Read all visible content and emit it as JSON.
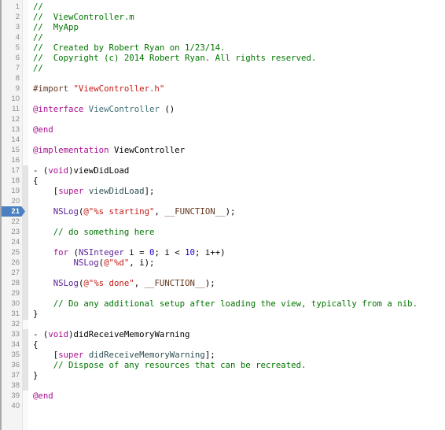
{
  "editor": {
    "file": "ViewController.m",
    "breakpoint_line": 21,
    "colors": {
      "comment": "#007400",
      "keyword": "#aa0d91",
      "string": "#c41a16",
      "number": "#1c00cf",
      "preproc": "#643820",
      "type": "#5c2699",
      "class": "#3f6e74",
      "method": "#2e4d52",
      "breakpoint": "#4a7fc1"
    },
    "lines": [
      {
        "n": "1",
        "tokens": [
          [
            "comment",
            "//"
          ]
        ]
      },
      {
        "n": "2",
        "tokens": [
          [
            "comment",
            "//  ViewController.m"
          ]
        ]
      },
      {
        "n": "3",
        "tokens": [
          [
            "comment",
            "//  MyApp"
          ]
        ]
      },
      {
        "n": "4",
        "tokens": [
          [
            "comment",
            "//"
          ]
        ]
      },
      {
        "n": "5",
        "tokens": [
          [
            "comment",
            "//  Created by Robert Ryan on 1/23/14."
          ]
        ]
      },
      {
        "n": "6",
        "tokens": [
          [
            "comment",
            "//  Copyright (c) 2014 Robert Ryan. All rights reserved."
          ]
        ]
      },
      {
        "n": "7",
        "tokens": [
          [
            "comment",
            "//"
          ]
        ]
      },
      {
        "n": "8",
        "tokens": []
      },
      {
        "n": "9",
        "tokens": [
          [
            "preproc",
            "#import "
          ],
          [
            "string",
            "\"ViewController.h\""
          ]
        ]
      },
      {
        "n": "10",
        "tokens": []
      },
      {
        "n": "11",
        "tokens": [
          [
            "keyword",
            "@interface"
          ],
          [
            "plain",
            " "
          ],
          [
            "class",
            "ViewController"
          ],
          [
            "plain",
            " ()"
          ]
        ]
      },
      {
        "n": "12",
        "tokens": []
      },
      {
        "n": "13",
        "tokens": [
          [
            "keyword",
            "@end"
          ]
        ]
      },
      {
        "n": "14",
        "tokens": []
      },
      {
        "n": "15",
        "tokens": [
          [
            "keyword",
            "@implementation"
          ],
          [
            "plain",
            " ViewController"
          ]
        ]
      },
      {
        "n": "16",
        "tokens": []
      },
      {
        "n": "17",
        "tokens": [
          [
            "plain",
            "- ("
          ],
          [
            "keyword",
            "void"
          ],
          [
            "plain",
            ")viewDidLoad"
          ]
        ]
      },
      {
        "n": "18",
        "tokens": [
          [
            "plain",
            "{"
          ]
        ]
      },
      {
        "n": "19",
        "tokens": [
          [
            "plain",
            "    ["
          ],
          [
            "keyword",
            "super"
          ],
          [
            "plain",
            " "
          ],
          [
            "method",
            "viewDidLoad"
          ],
          [
            "plain",
            "];"
          ]
        ]
      },
      {
        "n": "20",
        "tokens": []
      },
      {
        "n": "21",
        "tokens": [
          [
            "plain",
            "    "
          ],
          [
            "type",
            "NSLog"
          ],
          [
            "plain",
            "("
          ],
          [
            "string",
            "@\"%s starting\""
          ],
          [
            "plain",
            ", "
          ],
          [
            "macro",
            "__FUNCTION__"
          ],
          [
            "plain",
            ");"
          ]
        ]
      },
      {
        "n": "22",
        "tokens": []
      },
      {
        "n": "23",
        "tokens": [
          [
            "plain",
            "    "
          ],
          [
            "comment",
            "// do something here"
          ]
        ]
      },
      {
        "n": "24",
        "tokens": []
      },
      {
        "n": "25",
        "tokens": [
          [
            "plain",
            "    "
          ],
          [
            "keyword",
            "for"
          ],
          [
            "plain",
            " ("
          ],
          [
            "type",
            "NSInteger"
          ],
          [
            "plain",
            " i = "
          ],
          [
            "number",
            "0"
          ],
          [
            "plain",
            "; i < "
          ],
          [
            "number",
            "10"
          ],
          [
            "plain",
            "; i++)"
          ]
        ]
      },
      {
        "n": "26",
        "tokens": [
          [
            "plain",
            "        "
          ],
          [
            "type",
            "NSLog"
          ],
          [
            "plain",
            "("
          ],
          [
            "string",
            "@\"%d\""
          ],
          [
            "plain",
            ", i);"
          ]
        ]
      },
      {
        "n": "27",
        "tokens": []
      },
      {
        "n": "28",
        "tokens": [
          [
            "plain",
            "    "
          ],
          [
            "type",
            "NSLog"
          ],
          [
            "plain",
            "("
          ],
          [
            "string",
            "@\"%s done\""
          ],
          [
            "plain",
            ", "
          ],
          [
            "macro",
            "__FUNCTION__"
          ],
          [
            "plain",
            ");"
          ]
        ]
      },
      {
        "n": "29",
        "tokens": []
      },
      {
        "n": "30",
        "tokens": [
          [
            "plain",
            "    "
          ],
          [
            "comment",
            "// Do any additional setup after loading the view, typically from a nib."
          ]
        ]
      },
      {
        "n": "31",
        "tokens": [
          [
            "plain",
            "}"
          ]
        ]
      },
      {
        "n": "32",
        "tokens": []
      },
      {
        "n": "33",
        "tokens": [
          [
            "plain",
            "- ("
          ],
          [
            "keyword",
            "void"
          ],
          [
            "plain",
            ")didReceiveMemoryWarning"
          ]
        ]
      },
      {
        "n": "34",
        "tokens": [
          [
            "plain",
            "{"
          ]
        ]
      },
      {
        "n": "35",
        "tokens": [
          [
            "plain",
            "    ["
          ],
          [
            "keyword",
            "super"
          ],
          [
            "plain",
            " "
          ],
          [
            "method",
            "didReceiveMemoryWarning"
          ],
          [
            "plain",
            "];"
          ]
        ]
      },
      {
        "n": "36",
        "tokens": [
          [
            "plain",
            "    "
          ],
          [
            "comment",
            "// Dispose of any resources that can be recreated."
          ]
        ]
      },
      {
        "n": "37",
        "tokens": [
          [
            "plain",
            "}"
          ]
        ]
      },
      {
        "n": "38",
        "tokens": []
      },
      {
        "n": "39",
        "tokens": [
          [
            "keyword",
            "@end"
          ]
        ]
      },
      {
        "n": "40",
        "tokens": []
      }
    ]
  }
}
